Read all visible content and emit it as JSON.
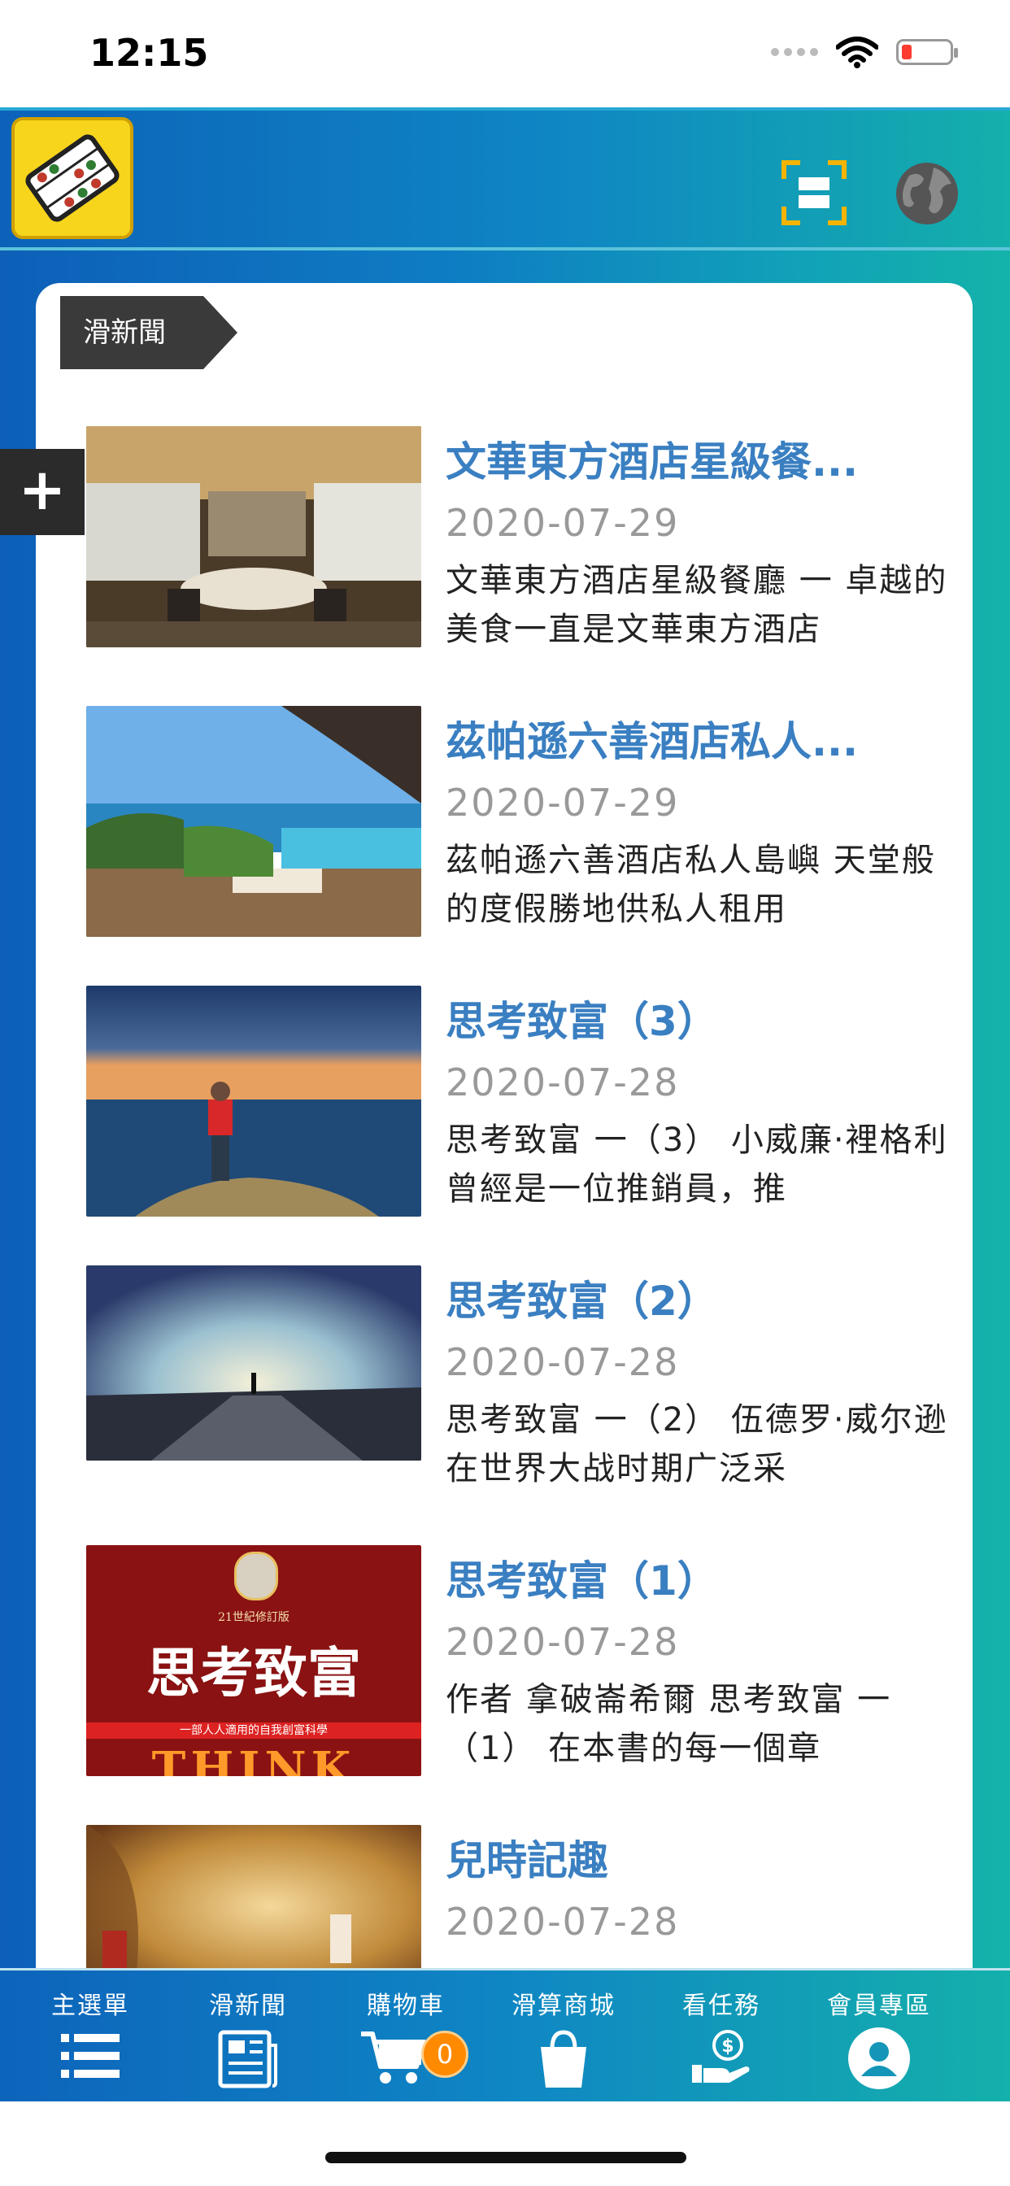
{
  "status_bar": {
    "time": "12:15"
  },
  "header": {
    "logo": "abacus-logo",
    "scan_icon": "scan-icon",
    "globe_icon": "globe-icon"
  },
  "section": {
    "title": "滑新聞",
    "add_symbol": "+"
  },
  "news": [
    {
      "title": "文華東方酒店星級餐...",
      "date": "2020-07-29",
      "summary": "文華東方酒店星級餐廳 一 卓越的美食一直是文華東方酒店",
      "thumb": "restaurant"
    },
    {
      "title": "茲帕遜六善酒店私人...",
      "date": "2020-07-29",
      "summary": "茲帕遜六善酒店私人島嶼 天堂般的度假勝地供私人租用",
      "thumb": "villa-pool"
    },
    {
      "title": "思考致富（3）",
      "date": "2020-07-28",
      "summary": "思考致富 一（3） 小威廉·裡格利 曾經是一位推銷員，推",
      "thumb": "sea-cliff"
    },
    {
      "title": "思考致富（2）",
      "date": "2020-07-28",
      "summary": "思考致富 一（2）  伍德罗·威尔逊在世界大战时期广泛采",
      "thumb": "road-sky"
    },
    {
      "title": "思考致富（1）",
      "date": "2020-07-28",
      "summary": "作者 拿破崙希爾 思考致富 一（1）  在本書的每一個章",
      "thumb": "book-cover",
      "cover": {
        "edition": "21世紀修訂版",
        "title": "思考致富",
        "subtitle": "一部人人適用的自我創富科學",
        "big": "THINK"
      }
    },
    {
      "title": "兒時記趣",
      "date": "2020-07-28",
      "summary": "",
      "thumb": "children-forest"
    }
  ],
  "tabs": [
    {
      "label": "主選單",
      "icon": "list-icon"
    },
    {
      "label": "滑新聞",
      "icon": "newspaper-icon"
    },
    {
      "label": "購物車",
      "icon": "cart-icon",
      "badge": "0"
    },
    {
      "label": "滑算商城",
      "icon": "shopping-bag-icon"
    },
    {
      "label": "看任務",
      "icon": "money-hand-icon"
    },
    {
      "label": "會員專區",
      "icon": "user-icon"
    }
  ]
}
